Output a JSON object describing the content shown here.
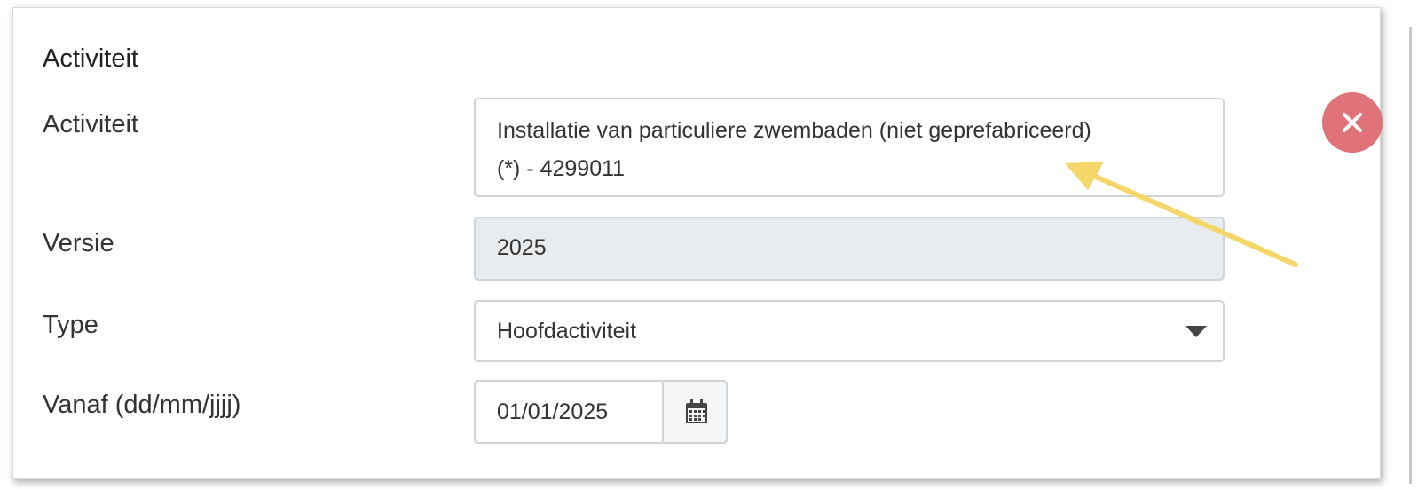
{
  "section": {
    "title": "Activiteit"
  },
  "form": {
    "activity": {
      "label": "Activiteit",
      "value_line1": "Installatie van particuliere zwembaden (niet geprefabriceerd)",
      "value_line2": "(*) - 4299011"
    },
    "version": {
      "label": "Versie",
      "value": "2025"
    },
    "type": {
      "label": "Type",
      "selected": "Hoofdactiviteit"
    },
    "from_date": {
      "label": "Vanaf (dd/mm/jjjj)",
      "value": "01/01/2025"
    }
  },
  "icons": {
    "remove": "close-icon",
    "calendar": "calendar-icon",
    "dropdown": "caret-down-icon"
  },
  "colors": {
    "remove_button": "#e0727a",
    "readonly_field": "#e9ecef",
    "annotation_arrow": "#f5d66b"
  }
}
